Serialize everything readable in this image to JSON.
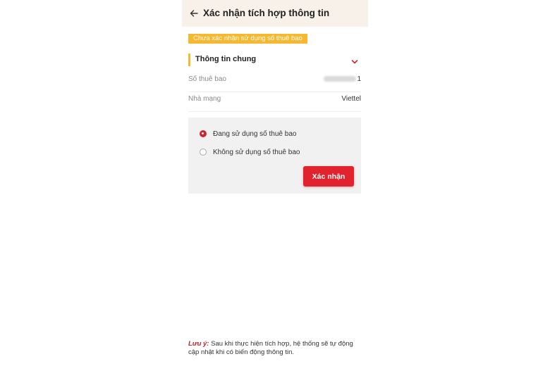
{
  "header": {
    "title": "Xác nhận tích hợp thông tin",
    "back_icon": "arrow-left-icon"
  },
  "status_badge": {
    "text": "Chưa xác nhận sử dụng số thuê bao",
    "color": "#f5b82e"
  },
  "section": {
    "title": "Thông tin chung",
    "toggle_icon": "chevron-down-icon",
    "accent_color": "#f5b82e"
  },
  "info_rows": [
    {
      "label": "Số thuê bao",
      "value_suffix": "1",
      "value_masked": true
    },
    {
      "label": "Nhà mạng",
      "value": "Viettel"
    }
  ],
  "options": [
    {
      "label": "Đang sử dụng số thuê bao",
      "selected": true
    },
    {
      "label": "Không sử dụng số thuê bao",
      "selected": false
    }
  ],
  "confirm_button": {
    "label": "Xác nhận",
    "color": "#e0232c"
  },
  "note": {
    "label": "Lưu ý:",
    "text": " Sau khi thực hiện tích hợp, hệ thống sẽ tự động cập nhật khi có biến động thông tin."
  }
}
